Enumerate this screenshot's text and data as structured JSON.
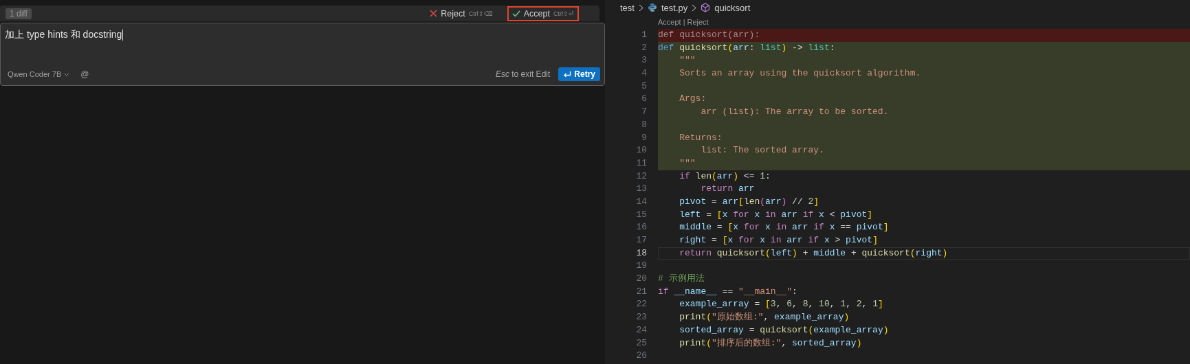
{
  "edit_panel": {
    "diff_count": "1 diff",
    "actions": [
      {
        "kind": "reject",
        "label": "Reject",
        "shortcut": "Ctrl⇧⌫",
        "highlighted": false
      },
      {
        "kind": "accept",
        "label": "Accept",
        "shortcut": "Ctrl⇧⏎",
        "highlighted": true
      }
    ],
    "prompt": {
      "value": "加上 type hints 和 docstring"
    },
    "model": "Qwen Coder 7B",
    "mention": "@",
    "hint": "*Esc* to exit Edit",
    "retry": "Retry"
  },
  "editor": {
    "breadcrumb": [
      {
        "kind": "folder",
        "label": "test"
      },
      {
        "kind": "python",
        "label": "test.py"
      },
      {
        "kind": "symbol",
        "label": "quicksort"
      }
    ],
    "codelens": [
      "Accept",
      "|",
      "Reject"
    ],
    "lines": [
      {
        "number": "1",
        "kind": "removed",
        "current": false,
        "tokens": [
          {
            "kind": "p",
            "text": "def quicksort(arr):"
          }
        ]
      },
      {
        "number": "2",
        "kind": "added",
        "current": false,
        "tokens": [
          {
            "kind": "kw",
            "text": "def"
          },
          {
            "kind": "fn",
            "text": " quicksort"
          },
          {
            "kind": "b1",
            "text": "("
          },
          {
            "kind": "var",
            "text": "arr"
          },
          {
            "kind": "op",
            "text": ": "
          },
          {
            "kind": "type",
            "text": "list"
          },
          {
            "kind": "b1",
            "text": ")"
          },
          {
            "kind": "op",
            "text": " -> "
          },
          {
            "kind": "type",
            "text": "list"
          },
          {
            "kind": "op",
            "text": ":"
          }
        ]
      },
      {
        "number": "3",
        "kind": "added",
        "current": false,
        "tokens": [
          {
            "kind": "str",
            "text": "    \"\"\""
          }
        ]
      },
      {
        "number": "4",
        "kind": "added",
        "current": false,
        "tokens": [
          {
            "kind": "str",
            "text": "    Sorts an array using the quicksort algorithm."
          }
        ]
      },
      {
        "number": "5",
        "kind": "added",
        "current": false
      },
      {
        "number": "6",
        "kind": "added",
        "current": false,
        "tokens": [
          {
            "kind": "str",
            "text": "    Args:"
          }
        ]
      },
      {
        "number": "7",
        "kind": "added",
        "current": false,
        "tokens": [
          {
            "kind": "str",
            "text": "        arr (list): The array to be sorted."
          }
        ]
      },
      {
        "number": "8",
        "kind": "added",
        "current": false
      },
      {
        "number": "9",
        "kind": "added",
        "current": false,
        "tokens": [
          {
            "kind": "str",
            "text": "    Returns:"
          }
        ]
      },
      {
        "number": "10",
        "kind": "added",
        "current": false,
        "tokens": [
          {
            "kind": "str",
            "text": "        list: The sorted array."
          }
        ]
      },
      {
        "number": "11",
        "kind": "added",
        "current": false,
        "tokens": [
          {
            "kind": "str",
            "text": "    \"\"\""
          }
        ]
      },
      {
        "number": "12",
        "kind": "context",
        "current": false,
        "tokens": [
          {
            "kind": "ctl",
            "text": "    if"
          },
          {
            "kind": "fn",
            "text": " len"
          },
          {
            "kind": "b1",
            "text": "("
          },
          {
            "kind": "var",
            "text": "arr"
          },
          {
            "kind": "b1",
            "text": ")"
          },
          {
            "kind": "op",
            "text": " <= "
          },
          {
            "kind": "num",
            "text": "1"
          },
          {
            "kind": "op",
            "text": ":"
          }
        ]
      },
      {
        "number": "13",
        "kind": "context",
        "current": false,
        "tokens": [
          {
            "kind": "ctl",
            "text": "        return"
          },
          {
            "kind": "var",
            "text": " arr"
          }
        ]
      },
      {
        "number": "14",
        "kind": "context",
        "current": false,
        "tokens": [
          {
            "kind": "var",
            "text": "    pivot"
          },
          {
            "kind": "op",
            "text": " = "
          },
          {
            "kind": "var",
            "text": "arr"
          },
          {
            "kind": "b1",
            "text": "["
          },
          {
            "kind": "fn",
            "text": "len"
          },
          {
            "kind": "b2",
            "text": "("
          },
          {
            "kind": "var",
            "text": "arr"
          },
          {
            "kind": "b2",
            "text": ")"
          },
          {
            "kind": "op",
            "text": " // "
          },
          {
            "kind": "num",
            "text": "2"
          },
          {
            "kind": "b1",
            "text": "]"
          }
        ]
      },
      {
        "number": "15",
        "kind": "context",
        "current": false,
        "tokens": [
          {
            "kind": "var",
            "text": "    left"
          },
          {
            "kind": "op",
            "text": " = "
          },
          {
            "kind": "b1",
            "text": "["
          },
          {
            "kind": "var",
            "text": "x "
          },
          {
            "kind": "ctl",
            "text": "for"
          },
          {
            "kind": "var",
            "text": " x "
          },
          {
            "kind": "ctl",
            "text": "in"
          },
          {
            "kind": "var",
            "text": " arr "
          },
          {
            "kind": "ctl",
            "text": "if"
          },
          {
            "kind": "var",
            "text": " x "
          },
          {
            "kind": "op",
            "text": "<"
          },
          {
            "kind": "var",
            "text": " pivot"
          },
          {
            "kind": "b1",
            "text": "]"
          }
        ]
      },
      {
        "number": "16",
        "kind": "context",
        "current": false,
        "tokens": [
          {
            "kind": "var",
            "text": "    middle"
          },
          {
            "kind": "op",
            "text": " = "
          },
          {
            "kind": "b1",
            "text": "["
          },
          {
            "kind": "var",
            "text": "x "
          },
          {
            "kind": "ctl",
            "text": "for"
          },
          {
            "kind": "var",
            "text": " x "
          },
          {
            "kind": "ctl",
            "text": "in"
          },
          {
            "kind": "var",
            "text": " arr "
          },
          {
            "kind": "ctl",
            "text": "if"
          },
          {
            "kind": "var",
            "text": " x "
          },
          {
            "kind": "op",
            "text": "=="
          },
          {
            "kind": "var",
            "text": " pivot"
          },
          {
            "kind": "b1",
            "text": "]"
          }
        ]
      },
      {
        "number": "17",
        "kind": "context",
        "current": false,
        "tokens": [
          {
            "kind": "var",
            "text": "    right"
          },
          {
            "kind": "op",
            "text": " = "
          },
          {
            "kind": "b1",
            "text": "["
          },
          {
            "kind": "var",
            "text": "x "
          },
          {
            "kind": "ctl",
            "text": "for"
          },
          {
            "kind": "var",
            "text": " x "
          },
          {
            "kind": "ctl",
            "text": "in"
          },
          {
            "kind": "var",
            "text": " arr "
          },
          {
            "kind": "ctl",
            "text": "if"
          },
          {
            "kind": "var",
            "text": " x "
          },
          {
            "kind": "op",
            "text": ">"
          },
          {
            "kind": "var",
            "text": " pivot"
          },
          {
            "kind": "b1",
            "text": "]"
          }
        ]
      },
      {
        "number": "18",
        "kind": "context",
        "current": true,
        "tokens": [
          {
            "kind": "ctl",
            "text": "    return"
          },
          {
            "kind": "fn",
            "text": " quicksort"
          },
          {
            "kind": "b1",
            "text": "("
          },
          {
            "kind": "var",
            "text": "left"
          },
          {
            "kind": "b1",
            "text": ")"
          },
          {
            "kind": "op",
            "text": " + "
          },
          {
            "kind": "var",
            "text": "middle"
          },
          {
            "kind": "op",
            "text": " + "
          },
          {
            "kind": "fn",
            "text": "quicksort"
          },
          {
            "kind": "b1",
            "text": "("
          },
          {
            "kind": "var",
            "text": "right"
          },
          {
            "kind": "b1",
            "text": ")"
          }
        ]
      },
      {
        "number": "19",
        "kind": "context",
        "current": false
      },
      {
        "number": "20",
        "kind": "context",
        "current": false,
        "tokens": [
          {
            "kind": "com",
            "text": "# 示例用法"
          }
        ]
      },
      {
        "number": "21",
        "kind": "context",
        "current": false,
        "tokens": [
          {
            "kind": "ctl",
            "text": "if"
          },
          {
            "kind": "var",
            "text": " __name__"
          },
          {
            "kind": "op",
            "text": " == "
          },
          {
            "kind": "str",
            "text": "\"__main__\""
          },
          {
            "kind": "op",
            "text": ":"
          }
        ]
      },
      {
        "number": "22",
        "kind": "context",
        "current": false,
        "tokens": [
          {
            "kind": "var",
            "text": "    example_array"
          },
          {
            "kind": "op",
            "text": " = "
          },
          {
            "kind": "b1",
            "text": "["
          },
          {
            "kind": "num",
            "text": "3"
          },
          {
            "kind": "op",
            "text": ", "
          },
          {
            "kind": "num",
            "text": "6"
          },
          {
            "kind": "op",
            "text": ", "
          },
          {
            "kind": "num",
            "text": "8"
          },
          {
            "kind": "op",
            "text": ", "
          },
          {
            "kind": "num",
            "text": "10"
          },
          {
            "kind": "op",
            "text": ", "
          },
          {
            "kind": "num",
            "text": "1"
          },
          {
            "kind": "op",
            "text": ", "
          },
          {
            "kind": "num",
            "text": "2"
          },
          {
            "kind": "op",
            "text": ", "
          },
          {
            "kind": "num",
            "text": "1"
          },
          {
            "kind": "b1",
            "text": "]"
          }
        ]
      },
      {
        "number": "23",
        "kind": "context",
        "current": false,
        "tokens": [
          {
            "kind": "fn",
            "text": "    print"
          },
          {
            "kind": "b1",
            "text": "("
          },
          {
            "kind": "str",
            "text": "\"原始数组:\""
          },
          {
            "kind": "op",
            "text": ", "
          },
          {
            "kind": "var",
            "text": "example_array"
          },
          {
            "kind": "b1",
            "text": ")"
          }
        ]
      },
      {
        "number": "24",
        "kind": "context",
        "current": false,
        "tokens": [
          {
            "kind": "var",
            "text": "    sorted_array"
          },
          {
            "kind": "op",
            "text": " = "
          },
          {
            "kind": "fn",
            "text": "quicksort"
          },
          {
            "kind": "b1",
            "text": "("
          },
          {
            "kind": "var",
            "text": "example_array"
          },
          {
            "kind": "b1",
            "text": ")"
          }
        ]
      },
      {
        "number": "25",
        "kind": "context",
        "current": false,
        "tokens": [
          {
            "kind": "fn",
            "text": "    print"
          },
          {
            "kind": "b1",
            "text": "("
          },
          {
            "kind": "str",
            "text": "\"排序后的数组:\""
          },
          {
            "kind": "op",
            "text": ", "
          },
          {
            "kind": "var",
            "text": "sorted_array"
          },
          {
            "kind": "b1",
            "text": ")"
          }
        ]
      },
      {
        "number": "26",
        "kind": "context",
        "current": false
      }
    ]
  }
}
